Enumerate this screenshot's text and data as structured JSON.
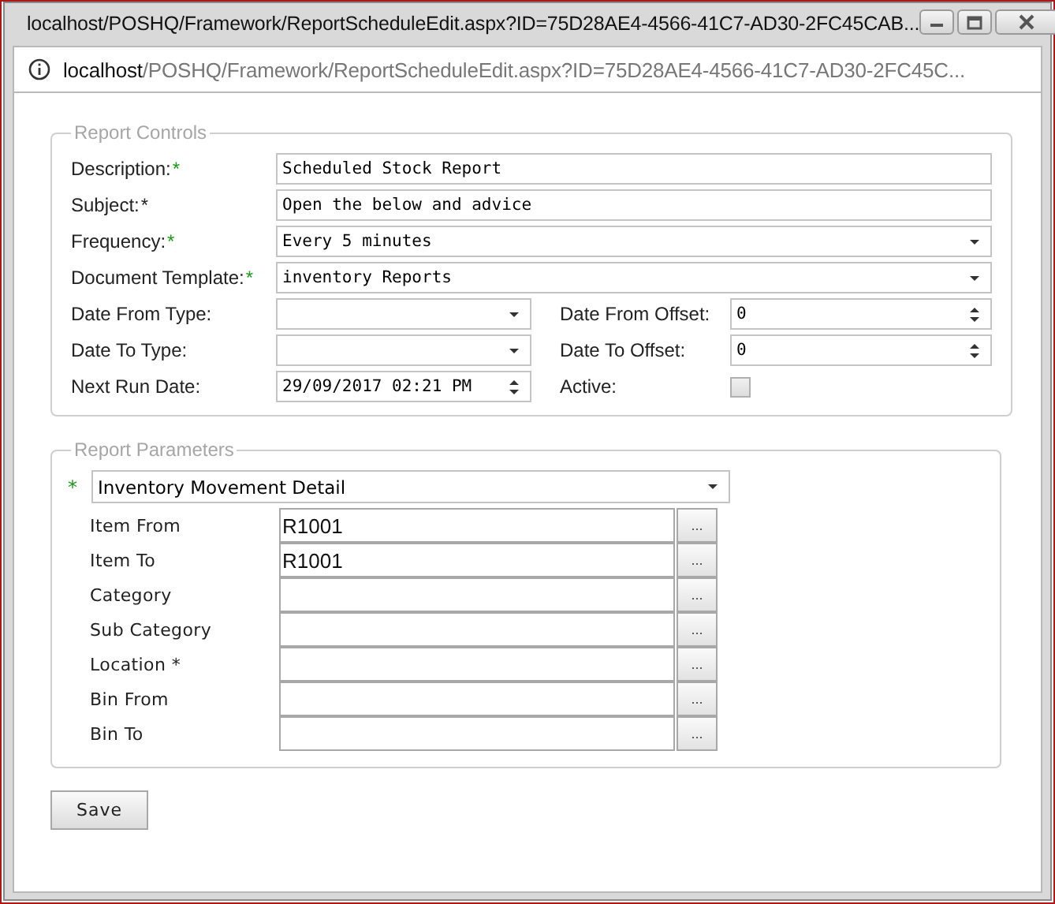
{
  "window": {
    "title": "localhost/POSHQ/Framework/ReportScheduleEdit.aspx?ID=75D28AE4-4566-41C7-AD30-2FC45CAB..."
  },
  "address_bar": {
    "host": "localhost",
    "path": "/POSHQ/Framework/ReportScheduleEdit.aspx?ID=75D28AE4-4566-41C7-AD30-2FC45C..."
  },
  "report_controls": {
    "legend": "Report Controls",
    "rows": [
      {
        "fields": [
          {
            "kind": "text",
            "label": "Description:",
            "required_mark": {
              "text": "*",
              "color": "#1a9a1a"
            },
            "value": "Scheduled Stock Report"
          }
        ]
      },
      {
        "fields": [
          {
            "kind": "text",
            "label": "Subject:",
            "required_mark": {
              "text": "*",
              "color": "#222222"
            },
            "value": "Open the below and advice"
          }
        ]
      },
      {
        "fields": [
          {
            "kind": "select",
            "label": "Frequency:",
            "required_mark": {
              "text": "*",
              "color": "#1a9a1a"
            },
            "value": "Every 5 minutes"
          }
        ]
      },
      {
        "fields": [
          {
            "kind": "select",
            "label": "Document Template:",
            "required_mark": {
              "text": "*",
              "color": "#1a9a1a"
            },
            "value": "inventory Reports"
          }
        ]
      },
      {
        "fields": [
          {
            "kind": "select",
            "label": "Date From Type:"
          },
          {
            "kind": "spinner",
            "label": "Date From Offset:",
            "value": "0"
          }
        ]
      },
      {
        "fields": [
          {
            "kind": "select",
            "label": "Date To Type:"
          },
          {
            "kind": "spinner",
            "label": "Date To Offset:",
            "value": "0"
          }
        ]
      },
      {
        "fields": [
          {
            "kind": "spinner",
            "label": "Next Run Date:",
            "value": "29/09/2017 02:21 PM"
          },
          {
            "kind": "checkbox",
            "label": "Active:",
            "checked": false
          }
        ]
      }
    ]
  },
  "report_parameters": {
    "legend": "Report Parameters",
    "report_select": {
      "required_mark": {
        "text": "*",
        "color": "#1a9a1a"
      },
      "value": "Inventory Movement Detail"
    },
    "rows": [
      {
        "label": "Item From",
        "value": "R1001",
        "button": "..."
      },
      {
        "label": "Item To",
        "value": "R1001",
        "button": "..."
      },
      {
        "label": "Category",
        "button": "..."
      },
      {
        "label": "Sub Category",
        "button": "..."
      },
      {
        "label": "Location *",
        "button": "..."
      },
      {
        "label": "Bin From",
        "button": "..."
      },
      {
        "label": "Bin To",
        "button": "..."
      }
    ]
  },
  "buttons": [
    "Save"
  ]
}
